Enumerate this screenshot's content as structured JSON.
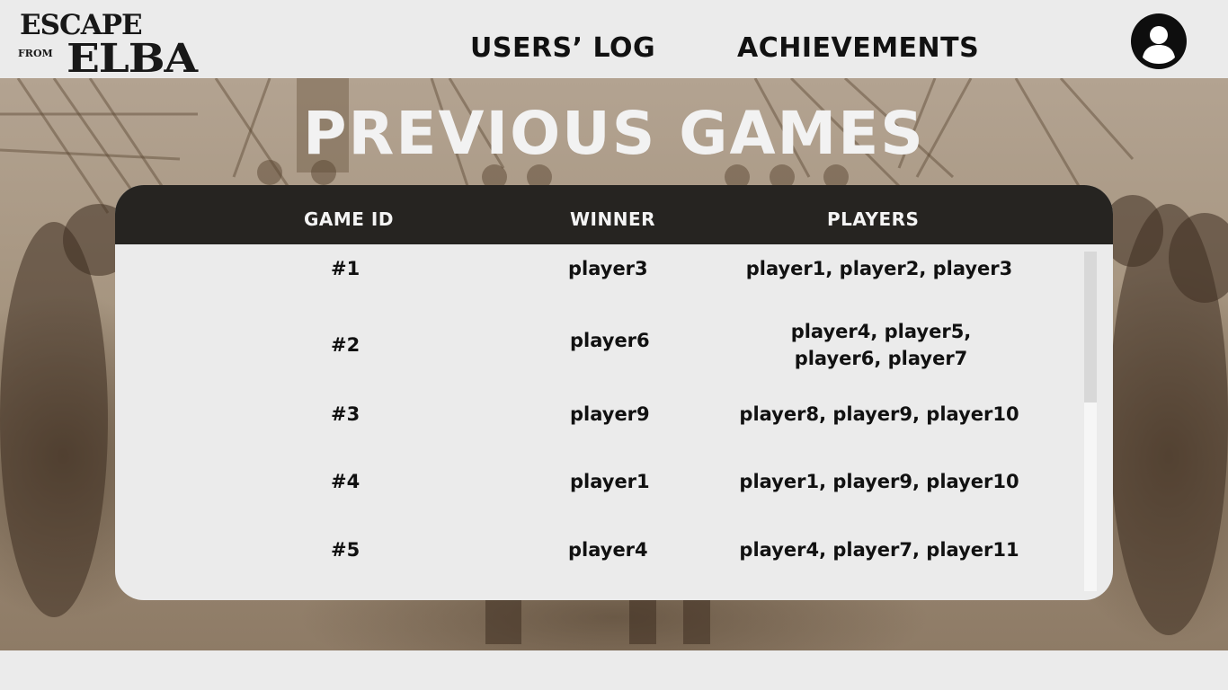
{
  "logo": {
    "line1": "ESCAPE",
    "line2a": "FROM",
    "line3": "ELBA"
  },
  "nav": {
    "users_log": "USERS’ LOG",
    "achievements": "ACHIEVEMENTS"
  },
  "page_title": "PREVIOUS GAMES",
  "table": {
    "headers": {
      "game_id": "GAME ID",
      "winner": "WINNER",
      "players": "PLAYERS"
    },
    "rows": [
      {
        "id": "#1",
        "winner": "player3",
        "players": "player1, player2, player3"
      },
      {
        "id": "#2",
        "winner": "player6",
        "players": "player4, player5, player6, player7"
      },
      {
        "id": "#3",
        "winner": "player9",
        "players": "player8, player9, player10"
      },
      {
        "id": "#4",
        "winner": "player1",
        "players": "player1, player9, player10"
      },
      {
        "id": "#5",
        "winner": "player4",
        "players": "player4, player7, player11"
      }
    ]
  },
  "icons": {
    "profile": "user-avatar-icon"
  },
  "colors": {
    "header_bg": "#ebebeb",
    "table_head": "#262421",
    "accent_text": "#111111",
    "title_text": "#f2f2f2"
  }
}
